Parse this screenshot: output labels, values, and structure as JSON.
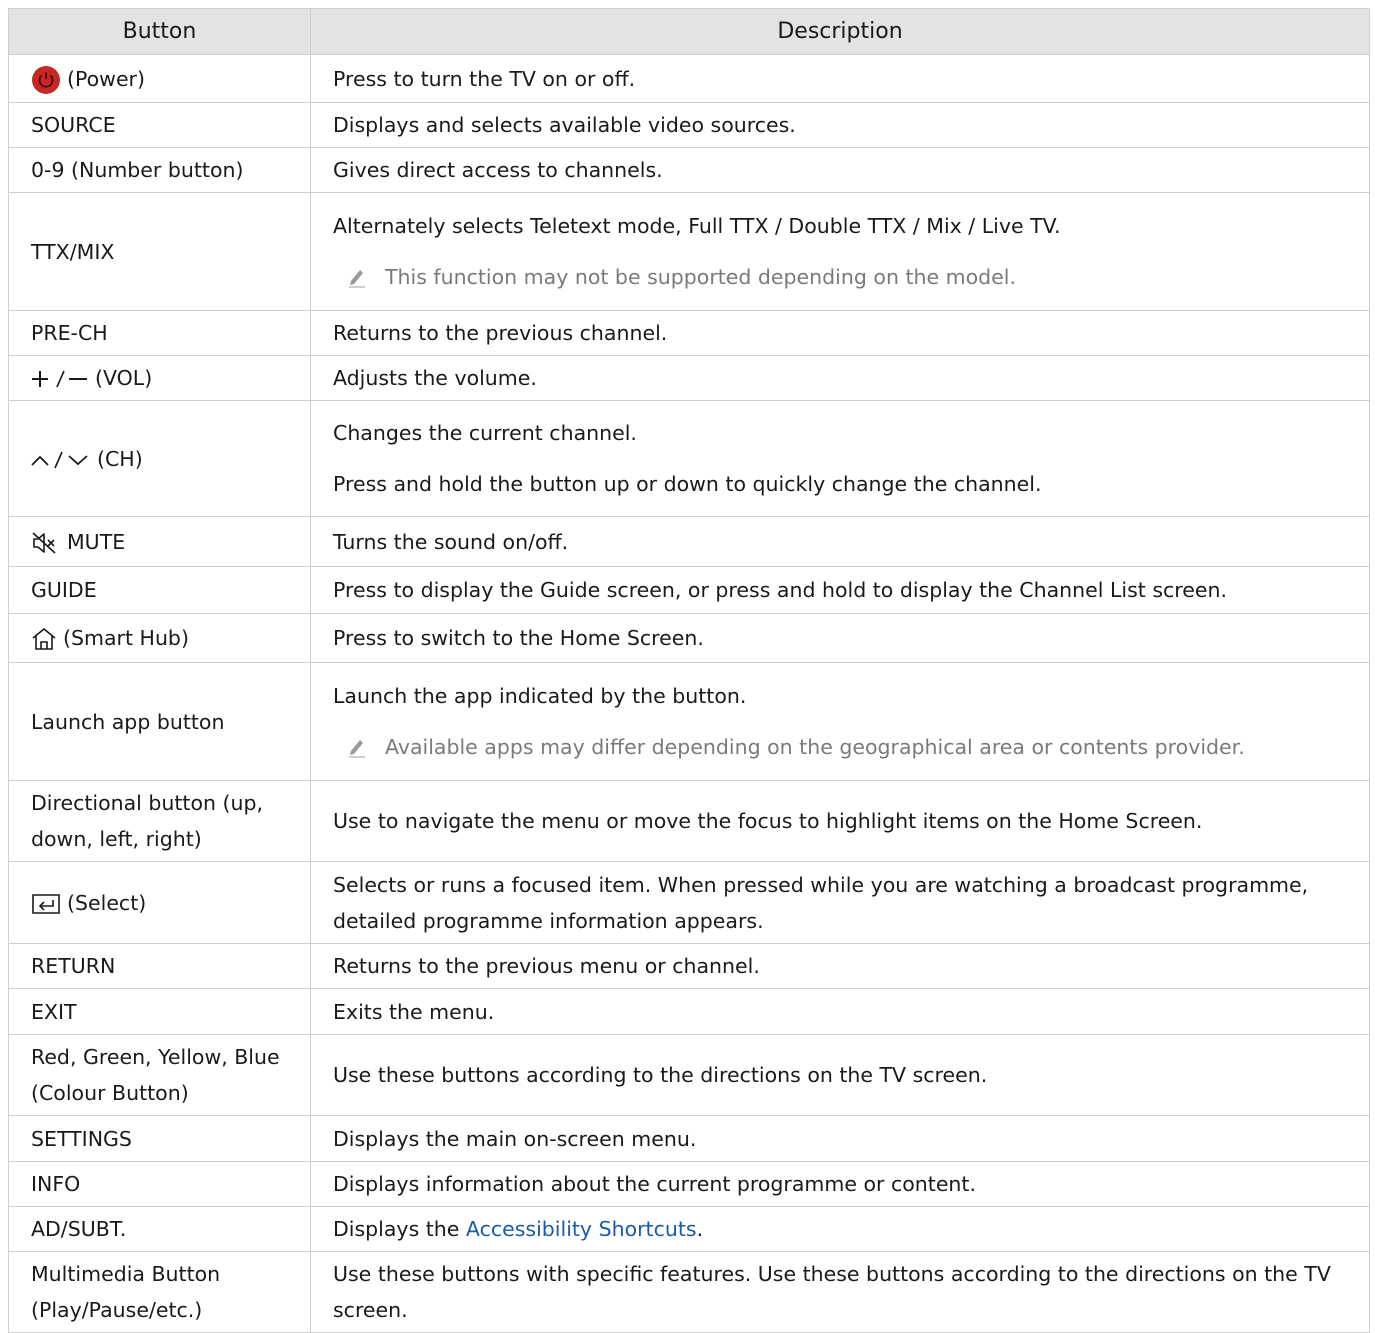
{
  "header": {
    "button": "Button",
    "description": "Description"
  },
  "rows": [
    {
      "button": "(Power)",
      "icon": "power-icon",
      "desc": [
        "Press to turn the TV on or off."
      ]
    },
    {
      "button": "SOURCE",
      "desc": [
        "Displays and selects available video sources."
      ]
    },
    {
      "button": "0-9 (Number button)",
      "desc": [
        "Gives direct access to channels."
      ]
    },
    {
      "button": "TTX/MIX",
      "desc": [
        "Alternately selects Teletext mode, Full TTX / Double TTX / Mix / Live TV."
      ],
      "note": "This function may not be supported depending on the model."
    },
    {
      "button": "PRE-CH",
      "desc": [
        "Returns to the previous channel."
      ]
    },
    {
      "button": "(VOL)",
      "icon": "plus-minus-icon",
      "desc": [
        "Adjusts the volume."
      ]
    },
    {
      "button": "(CH)",
      "icon": "chevron-up-down-icon",
      "desc": [
        "Changes the current channel.",
        "Press and hold the button up or down to quickly change the channel."
      ]
    },
    {
      "button": "MUTE",
      "icon": "mute-icon",
      "desc": [
        "Turns the sound on/off."
      ]
    },
    {
      "button": "GUIDE",
      "desc": [
        "Press to display the Guide screen, or press and hold to display the Channel List screen."
      ]
    },
    {
      "button": "(Smart Hub)",
      "icon": "home-icon",
      "desc": [
        "Press to switch to the Home Screen."
      ]
    },
    {
      "button": "Launch app button",
      "desc": [
        "Launch the app indicated by the button."
      ],
      "note": "Available apps may differ depending on the geographical area or contents provider."
    },
    {
      "button": "Directional button (up, down, left, right)",
      "desc": [
        "Use to navigate the menu or move the focus to highlight items on the Home Screen."
      ]
    },
    {
      "button": "(Select)",
      "icon": "select-icon",
      "desc": [
        "Selects or runs a focused item. When pressed while you are watching a broadcast programme, detailed programme information appears."
      ]
    },
    {
      "button": "RETURN",
      "desc": [
        "Returns to the previous menu or channel."
      ]
    },
    {
      "button": "EXIT",
      "desc": [
        "Exits the menu."
      ]
    },
    {
      "button": "Red, Green, Yellow, Blue (Colour Button)",
      "desc": [
        "Use these buttons according to the directions on the TV screen."
      ]
    },
    {
      "button": "SETTINGS",
      "desc": [
        "Displays the main on-screen menu."
      ]
    },
    {
      "button": "INFO",
      "desc": [
        "Displays information about the current programme or content."
      ]
    },
    {
      "button": "AD/SUBT.",
      "desc_parts": {
        "before": "Displays the ",
        "link": "Accessibility Shortcuts",
        "after": "."
      }
    },
    {
      "button": "Multimedia Button (Play/Pause/etc.)",
      "desc": [
        "Use these buttons with specific features. Use these buttons according to the directions on the TV screen."
      ]
    }
  ],
  "colors": {
    "header_bg": "#e3e3e3",
    "border": "#cfcfcf",
    "link": "#1a5ba8",
    "note": "#7a7a7a",
    "power": "#c62828"
  }
}
